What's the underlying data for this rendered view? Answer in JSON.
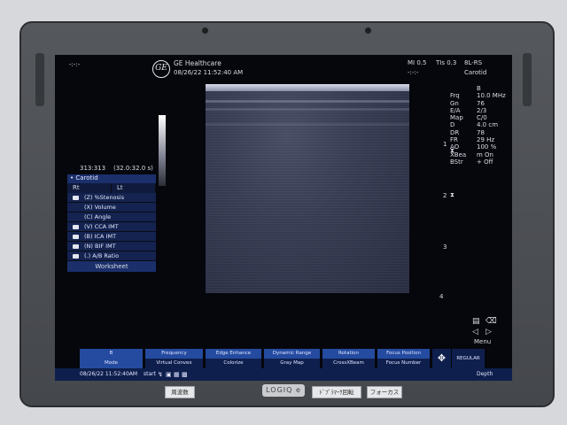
{
  "header": {
    "left_indicator": "-:-:-",
    "brand": "GE Healthcare",
    "logo_text": "GE",
    "datetime": "08/26/22 11:52:40 AM",
    "mi": "MI 0.5",
    "tis": "TIs 0.3",
    "probe": "8L-RS",
    "preset": "Carotid",
    "center_indicator": "-:-:-"
  },
  "frame_counter": "313:313",
  "frame_time": "(32.0:32.0 s)",
  "menu": {
    "title": "Carotid",
    "rt_label": "Rt",
    "lt_label": "Lt",
    "items": [
      {
        "label": "(Z) %Stenosis",
        "folder": true
      },
      {
        "label": "(X) Volume",
        "folder": false
      },
      {
        "label": "(C) Angle",
        "folder": false
      },
      {
        "label": "(V) CCA IMT",
        "folder": true
      },
      {
        "label": "(B) ICA IMT",
        "folder": true
      },
      {
        "label": "(N) BIF IMT",
        "folder": true
      },
      {
        "label": "(.) A/B Ratio",
        "folder": true
      }
    ],
    "worksheet": "Worksheet"
  },
  "params": [
    {
      "k": "",
      "v": "B"
    },
    {
      "k": "Frq",
      "v": "10.0 MHz"
    },
    {
      "k": "Gn",
      "v": "76"
    },
    {
      "k": "E/A",
      "v": "2/3"
    },
    {
      "k": "Map",
      "v": "C/0"
    },
    {
      "k": "D",
      "v": "4.0 cm"
    },
    {
      "k": "DR",
      "v": "78"
    },
    {
      "k": "FR",
      "v": "29 Hz"
    },
    {
      "k": "AO",
      "v": "100 %"
    },
    {
      "k": "XBea",
      "v": "m On"
    },
    {
      "k": "BStr",
      "v": "+ Off"
    }
  ],
  "depth_ticks": [
    "1",
    "2",
    "3",
    "4"
  ],
  "menu_label": "Menu",
  "softkeys": {
    "mode": "B",
    "mode_sub": "Mode",
    "frequency": "Frequency",
    "virtual_convex": "Virtual Convex",
    "edge_enhance": "Edge Enhance",
    "colorize": "Colorize",
    "dynamic_range": "Dynamic Range",
    "gray_map": "Gray Map",
    "rotation": "Rotation",
    "crossxbeam": "CrossXBeam",
    "focus_position": "Focus Position",
    "focus_number": "Focus Number",
    "regular": "REGULAR",
    "depth": "Depth"
  },
  "status": {
    "datetime": "08/26/22 11:52:40AM",
    "start": "start"
  },
  "device": {
    "model": "LOGIQ e",
    "key_left": "周波数",
    "key_mid": "ﾄﾞﾌﾟﾗﾏｰｸ回転",
    "key_right": "フォーカス"
  }
}
